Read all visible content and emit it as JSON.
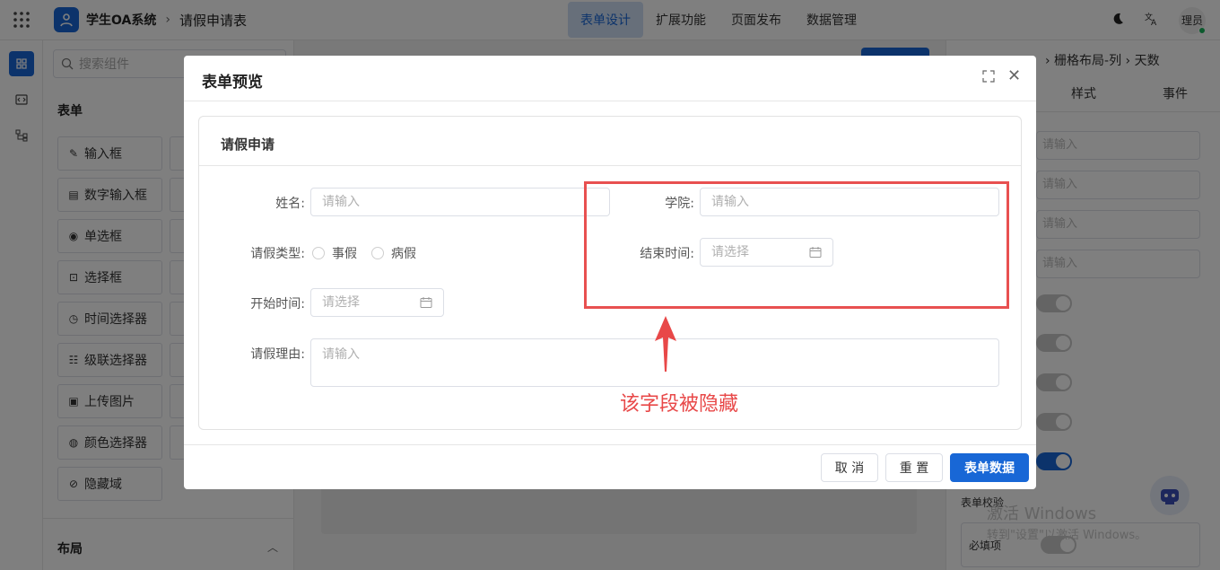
{
  "topbar": {
    "app_title": "学生OA系统",
    "breadcrumb_sep": "›",
    "page_name": "请假申请表",
    "nav": [
      "表单设计",
      "扩展功能",
      "页面发布",
      "数据管理"
    ],
    "user_name": "理员"
  },
  "panel": {
    "search_placeholder": "搜索组件",
    "section_title": "表单",
    "components": [
      {
        "label": "输入框",
        "icon": "edit-icon"
      },
      {
        "label": "数字输入框",
        "icon": "number-icon"
      },
      {
        "label": "单选框",
        "icon": "radio-icon"
      },
      {
        "label": "选择框",
        "icon": "select-icon"
      },
      {
        "label": "时间选择器",
        "icon": "clock-icon"
      },
      {
        "label": "级联选择器",
        "icon": "cascade-icon"
      },
      {
        "label": "上传图片",
        "icon": "image-icon"
      },
      {
        "label": "颜色选择器",
        "icon": "palette-icon"
      },
      {
        "label": "隐藏域",
        "icon": "eye-off-icon"
      }
    ],
    "layout_title": "布局"
  },
  "rightpanel": {
    "crumb": "› 栅格布局-列 › 天数",
    "tabs": [
      "样式",
      "事件"
    ],
    "input_placeholder": "请输入",
    "validation_label": "表单校验",
    "required_label": "必填项"
  },
  "watermark": {
    "line1": "激活 Windows",
    "line2": "转到\"设置\"以激活 Windows。"
  },
  "dialog": {
    "title": "表单预览",
    "card_title": "请假申请",
    "fields": {
      "name_label": "姓名:",
      "name_placeholder": "请输入",
      "college_label": "学院:",
      "college_placeholder": "请输入",
      "leave_type_label": "请假类型:",
      "leave_type_options": [
        "事假",
        "病假"
      ],
      "end_time_label": "结束时间:",
      "end_time_placeholder": "请选择",
      "start_time_label": "开始时间:",
      "start_time_placeholder": "请选择",
      "reason_label": "请假理由:",
      "reason_placeholder": "请输入"
    },
    "buttons": {
      "cancel": "取 消",
      "reset": "重 置",
      "data": "表单数据"
    }
  },
  "annotation": {
    "note": "该字段被隐藏",
    "color": "#e84848"
  },
  "colors": {
    "primary": "#1867d6"
  }
}
